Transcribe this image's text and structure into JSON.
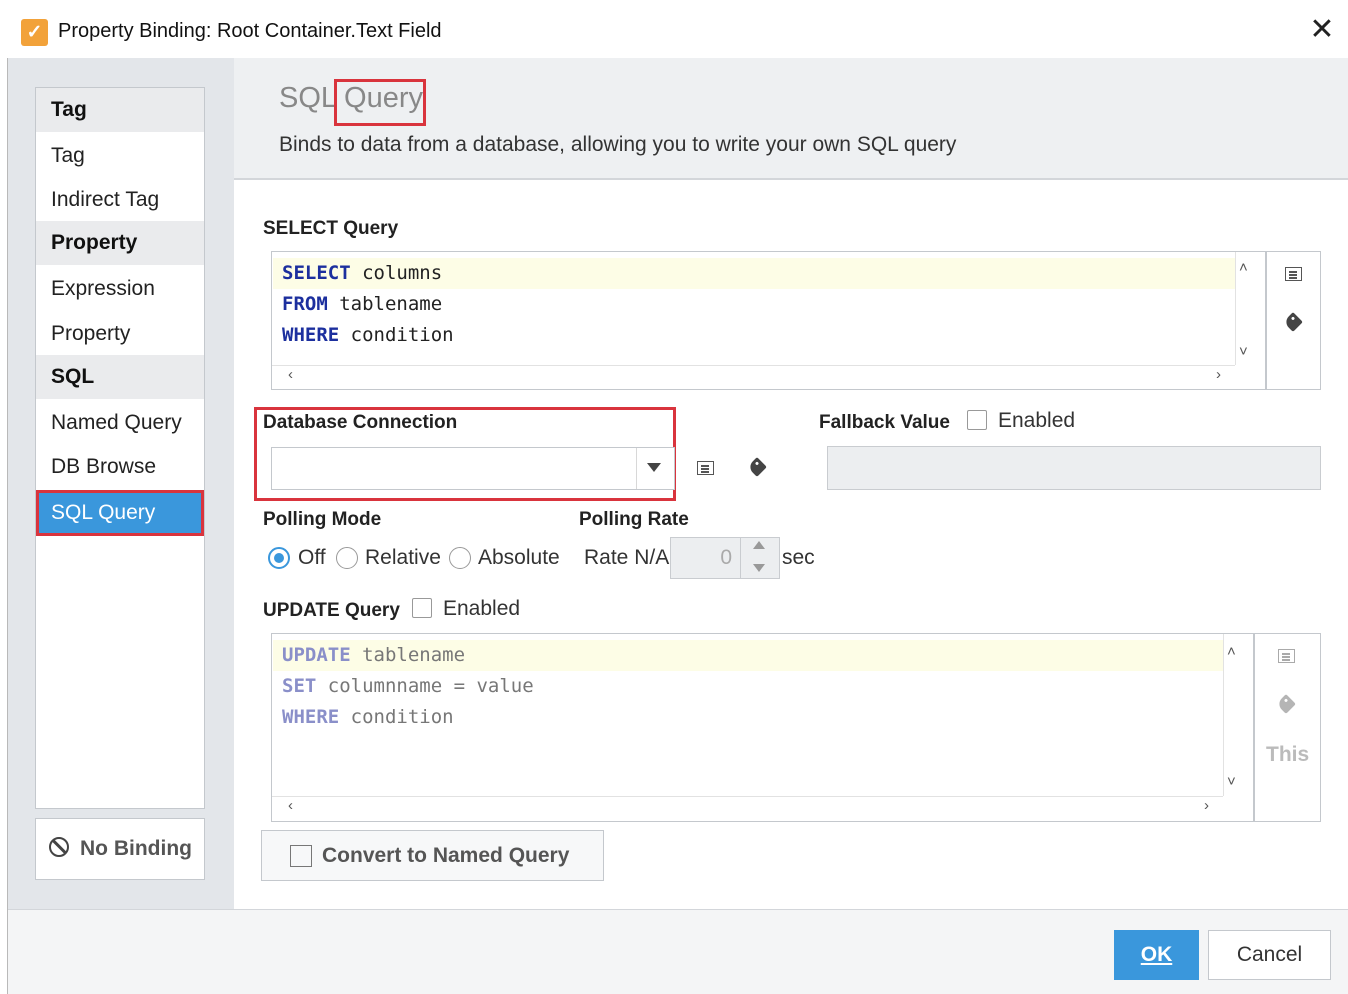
{
  "window": {
    "title": "Property Binding: Root Container.Text Field",
    "icon": "binding-app-icon",
    "close_glyph": "✕"
  },
  "sidebar": {
    "groups": [
      {
        "header": "Tag",
        "items": [
          "Tag",
          "Indirect Tag"
        ]
      },
      {
        "header": "Property",
        "items": [
          "Expression",
          "Property"
        ]
      },
      {
        "header": "SQL",
        "items": [
          "Named Query",
          "DB Browse",
          "SQL Query"
        ]
      }
    ],
    "selected": "SQL Query",
    "no_binding_label": "No Binding"
  },
  "header": {
    "title": "SQL Query",
    "description": "Binds to data from a database, allowing you to write your own SQL query"
  },
  "select_query": {
    "label": "SELECT Query",
    "lines": [
      {
        "keyword": "SELECT",
        "rest": " columns"
      },
      {
        "keyword": "FROM",
        "rest": " tablename"
      },
      {
        "keyword": "WHERE",
        "rest": " condition"
      }
    ]
  },
  "database_connection": {
    "label": "Database Connection",
    "value": ""
  },
  "fallback": {
    "label": "Fallback Value",
    "checkbox_label": "Enabled",
    "checked": false,
    "value": ""
  },
  "polling": {
    "mode_label": "Polling Mode",
    "rate_label": "Polling Rate",
    "options": [
      "Off",
      "Relative",
      "Absolute"
    ],
    "selected": "Off",
    "rate_text": "Rate N/A",
    "rate_value": "0",
    "unit": "sec"
  },
  "update_query": {
    "label": "UPDATE Query",
    "checkbox_label": "Enabled",
    "checked": false,
    "lines": [
      {
        "keyword": "UPDATE",
        "rest": " tablename"
      },
      {
        "keyword": "SET",
        "rest": " columnname = value"
      },
      {
        "keyword": "WHERE",
        "rest": " condition"
      }
    ],
    "this_label": "This"
  },
  "convert_button": "Convert to Named Query",
  "footer": {
    "ok_label": "OK",
    "cancel_label": "Cancel"
  },
  "colors": {
    "accent": "#3a97dc",
    "highlight_outline": "#d9343d",
    "keyword": "#1c2f9e"
  }
}
